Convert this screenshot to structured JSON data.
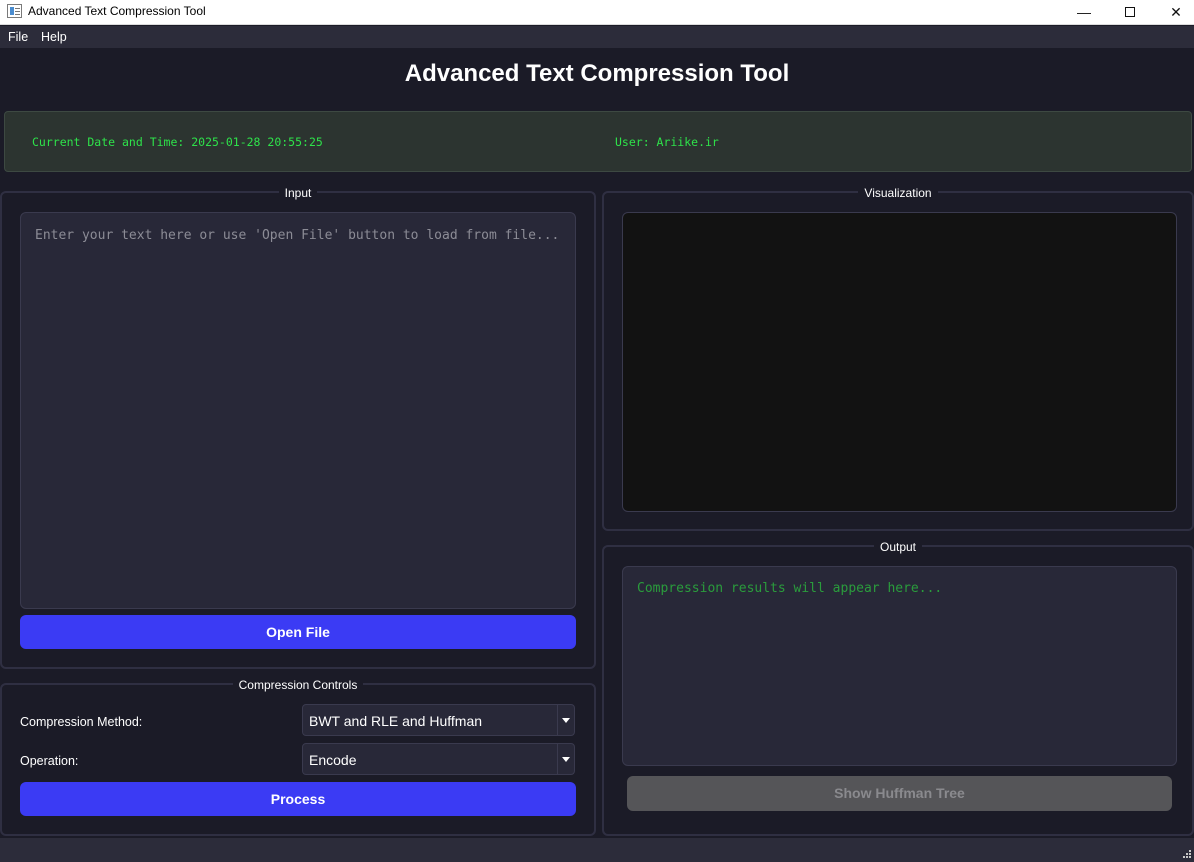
{
  "window": {
    "title": "Advanced Text Compression Tool",
    "minimize": "—",
    "close": "✕"
  },
  "menu": [
    "File",
    "Help"
  ],
  "heading": "Advanced Text Compression Tool",
  "info": {
    "datetime": "Current Date and Time: 2025-01-28 20:55:25",
    "user": "User: Ariike.ir"
  },
  "input": {
    "group_title": "Input",
    "placeholder": "Enter your text here or use 'Open File' button to load from file...",
    "open_file_label": "Open File"
  },
  "controls": {
    "group_title": "Compression Controls",
    "method_label": "Compression Method:",
    "method_value": "BWT and RLE and Huffman",
    "operation_label": "Operation:",
    "operation_value": "Encode",
    "process_label": "Process"
  },
  "visualization": {
    "group_title": "Visualization"
  },
  "output": {
    "group_title": "Output",
    "placeholder": "Compression results will appear here...",
    "huffman_button_label": "Show Huffman Tree"
  },
  "colors": {
    "background": "#1b1b27",
    "accent_button": "#3b3bf4",
    "info_text": "#2ee24a",
    "output_placeholder": "#2a9c3c",
    "disabled_button": "#555558"
  },
  "icons": {
    "app": "app-window-icon",
    "minimize": "minimize-icon",
    "maximize": "maximize-icon",
    "close": "close-icon",
    "dropdown": "chevron-down-icon",
    "resize": "resize-grip-icon"
  }
}
